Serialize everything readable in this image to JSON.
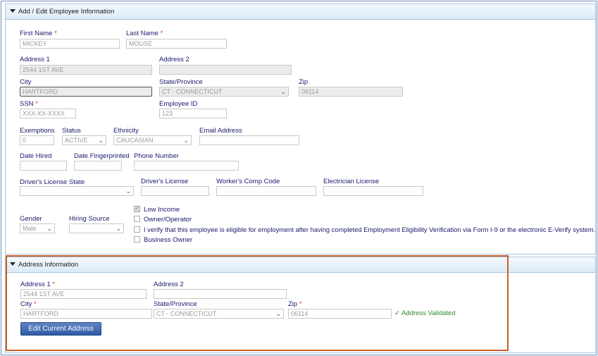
{
  "employee_panel": {
    "title": "Add / Edit Employee Information",
    "first_name": {
      "label": "First Name",
      "value": "MICKEY"
    },
    "last_name": {
      "label": "Last Name",
      "value": "MOUSE"
    },
    "address1": {
      "label": "Address 1",
      "value": "2544 1ST AVE"
    },
    "address2": {
      "label": "Address 2",
      "value": ""
    },
    "city": {
      "label": "City",
      "value": "HARTFORD"
    },
    "state": {
      "label": "State/Province",
      "value": "CT - CONNECTICUT"
    },
    "zip": {
      "label": "Zip",
      "value": "06114"
    },
    "ssn": {
      "label": "SSN",
      "value": "XXX-XX-XXXX"
    },
    "employee_id": {
      "label": "Employee ID",
      "value": "123"
    },
    "exemptions": {
      "label": "Exemptions",
      "value": "0"
    },
    "status": {
      "label": "Status",
      "value": "ACTIVE"
    },
    "ethnicity": {
      "label": "Ethnicity",
      "value": "CAUCASIAN"
    },
    "email": {
      "label": "Email Address",
      "value": ""
    },
    "date_hired": {
      "label": "Date Hired",
      "value": ""
    },
    "date_fingerprinted": {
      "label": "Date Fingerprinted",
      "value": ""
    },
    "phone": {
      "label": "Phone Number",
      "value": ""
    },
    "dl_state": {
      "label": "Driver's License State",
      "value": ""
    },
    "dl": {
      "label": "Driver's License",
      "value": ""
    },
    "workers_comp": {
      "label": "Worker's Comp Code",
      "value": ""
    },
    "electrician": {
      "label": "Electrician License",
      "value": ""
    },
    "gender": {
      "label": "Gender",
      "value": "Male"
    },
    "hiring_source": {
      "label": "Hiring Source",
      "value": ""
    },
    "checkboxes": [
      {
        "label": "Low Income",
        "checked": true
      },
      {
        "label": "Owner/Operator",
        "checked": false
      },
      {
        "label": "I verify that this employee is eligible for employment after having completed Employment Eligibility Verification via Form I-9 or the electronic E-Verify system.",
        "checked": false
      },
      {
        "label": "Business Owner",
        "checked": false
      }
    ],
    "required_mark": "*"
  },
  "address_panel": {
    "title": "Address Information",
    "address1": {
      "label": "Address 1",
      "value": "2544 1ST AVE"
    },
    "address2": {
      "label": "Address 2",
      "value": ""
    },
    "city": {
      "label": "City",
      "value": "HARTFORD"
    },
    "state": {
      "label": "State/Province",
      "value": "CT - CONNECTICUT"
    },
    "zip": {
      "label": "Zip",
      "value": "06114"
    },
    "validated_text": "✓ Address Validated",
    "edit_button": "Edit Current Address"
  },
  "icons": {
    "collapse": "caret-down-icon",
    "dropdown": "chevron-down-icon"
  },
  "colors": {
    "highlight_border": "#c8602a",
    "validated": "#2c8a2c",
    "button": "#2f5aa4",
    "label": "#1a1a6e",
    "required": "#d33333"
  }
}
